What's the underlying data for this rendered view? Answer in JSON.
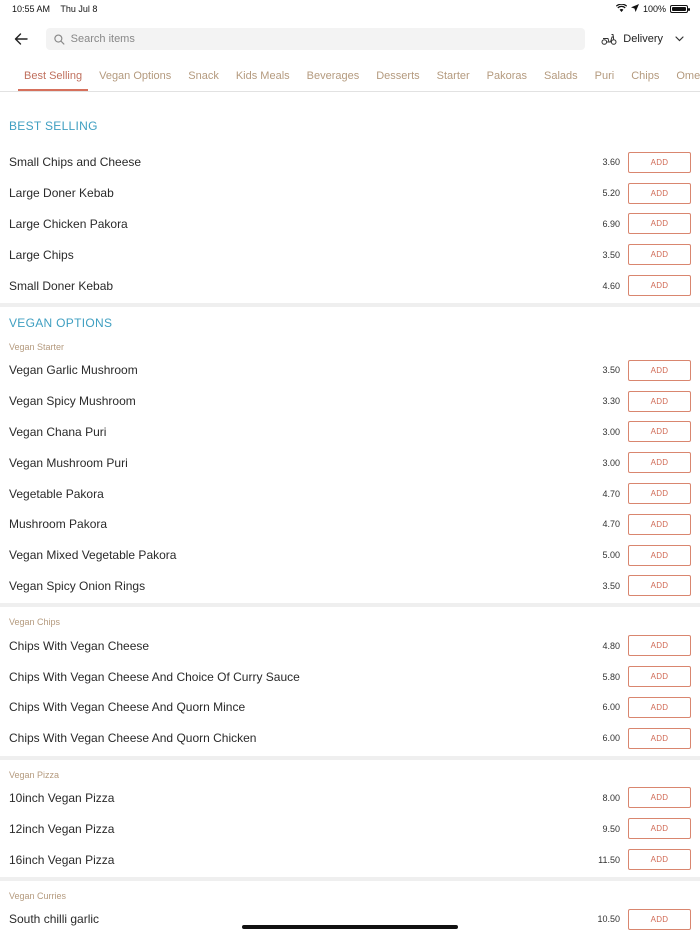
{
  "status_bar": {
    "time": "10:55 AM",
    "date": "Thu Jul 8",
    "battery": "100%",
    "battery_level": 1.0
  },
  "header": {
    "search_placeholder": "Search items",
    "delivery_label": "Delivery"
  },
  "tabs": [
    "Best Selling",
    "Vegan Options",
    "Snack",
    "Kids Meals",
    "Beverages",
    "Desserts",
    "Starter",
    "Pakoras",
    "Salads",
    "Puri",
    "Chips",
    "Omelette"
  ],
  "active_tab": "Best Selling",
  "add_label": "ADD",
  "best_selling": {
    "title": "BEST SELLING",
    "items": [
      {
        "name": "Small Chips and Cheese",
        "price": "3.60"
      },
      {
        "name": "Large Doner Kebab",
        "price": "5.20"
      },
      {
        "name": "Large Chicken Pakora",
        "price": "6.90"
      },
      {
        "name": "Large Chips",
        "price": "3.50"
      },
      {
        "name": "Small Doner Kebab",
        "price": "4.60"
      }
    ]
  },
  "vegan_options": {
    "title": "VEGAN OPTIONS",
    "groups": [
      {
        "title": "Vegan Starter",
        "items": [
          {
            "name": "Vegan Garlic Mushroom",
            "price": "3.50"
          },
          {
            "name": "Vegan Spicy Mushroom",
            "price": "3.30"
          },
          {
            "name": "Vegan Chana Puri",
            "price": "3.00"
          },
          {
            "name": "Vegan Mushroom Puri",
            "price": "3.00"
          },
          {
            "name": "Vegetable Pakora",
            "price": "4.70"
          },
          {
            "name": "Mushroom Pakora",
            "price": "4.70"
          },
          {
            "name": "Vegan Mixed Vegetable Pakora",
            "price": "5.00"
          },
          {
            "name": "Vegan Spicy Onion Rings",
            "price": "3.50"
          }
        ]
      },
      {
        "title": "Vegan Chips",
        "items": [
          {
            "name": "Chips With Vegan Cheese",
            "price": "4.80"
          },
          {
            "name": "Chips With Vegan Cheese And Choice Of Curry Sauce",
            "price": "5.80"
          },
          {
            "name": "Chips With Vegan Cheese And Quorn Mince",
            "price": "6.00"
          },
          {
            "name": "Chips With Vegan Cheese And Quorn Chicken",
            "price": "6.00"
          }
        ]
      },
      {
        "title": "Vegan Pizza",
        "items": [
          {
            "name": "10inch Vegan Pizza",
            "price": "8.00"
          },
          {
            "name": "12inch Vegan Pizza",
            "price": "9.50"
          },
          {
            "name": "16inch Vegan Pizza",
            "price": "11.50"
          }
        ]
      },
      {
        "title": "Vegan Curries",
        "items": [
          {
            "name": "South chilli garlic",
            "price": "10.50"
          }
        ]
      }
    ]
  }
}
